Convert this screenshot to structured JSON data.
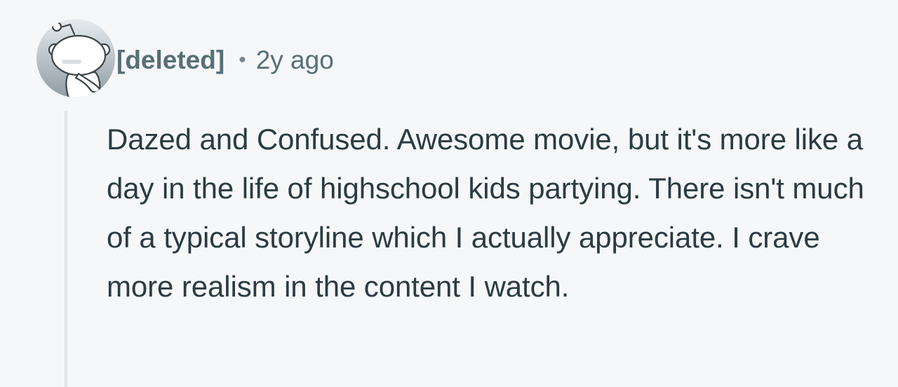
{
  "comment": {
    "author": "[deleted]",
    "separator": "•",
    "timestamp": "2y ago",
    "body": "Dazed and Confused. Awesome movie, but it's more like a day in the life of highschool kids partying. There isn't much of a typical storyline which I actually appreciate. I crave more realism in the content I watch."
  },
  "icons": {
    "avatar": "reddit-snoo-avatar-icon"
  },
  "colors": {
    "background": "#f6f7f8",
    "meta_text": "#576f76",
    "body_text": "#2a3c42",
    "thread_line": "#dfe4e8"
  }
}
